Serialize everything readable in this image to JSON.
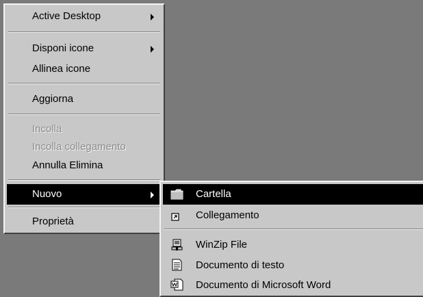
{
  "context_menu": {
    "items": [
      {
        "label": "Active Desktop",
        "has_submenu": true
      },
      {
        "label": "Disponi icone",
        "has_submenu": true
      },
      {
        "label": "Allinea icone"
      },
      {
        "label": "Aggiorna"
      },
      {
        "label": "Incolla",
        "disabled": true
      },
      {
        "label": "Incolla collegamento",
        "disabled": true
      },
      {
        "label": "Annulla Elimina"
      },
      {
        "label": "Nuovo",
        "has_submenu": true,
        "selected": true
      },
      {
        "label": "Proprietà"
      }
    ]
  },
  "submenu_nuovo": {
    "items": [
      {
        "label": "Cartella",
        "icon": "folder-icon",
        "selected": true
      },
      {
        "label": "Collegamento",
        "icon": "shortcut-icon"
      },
      {
        "label": "WinZip File",
        "icon": "winzip-icon"
      },
      {
        "label": "Documento di testo",
        "icon": "text-document-icon"
      },
      {
        "label": "Documento di Microsoft Word",
        "icon": "word-document-icon"
      }
    ]
  },
  "colors": {
    "menu_face": "#c8c8c8",
    "desktop": "#7a7a7a",
    "highlight": "#000000",
    "disabled_text": "#8c8c8c"
  }
}
